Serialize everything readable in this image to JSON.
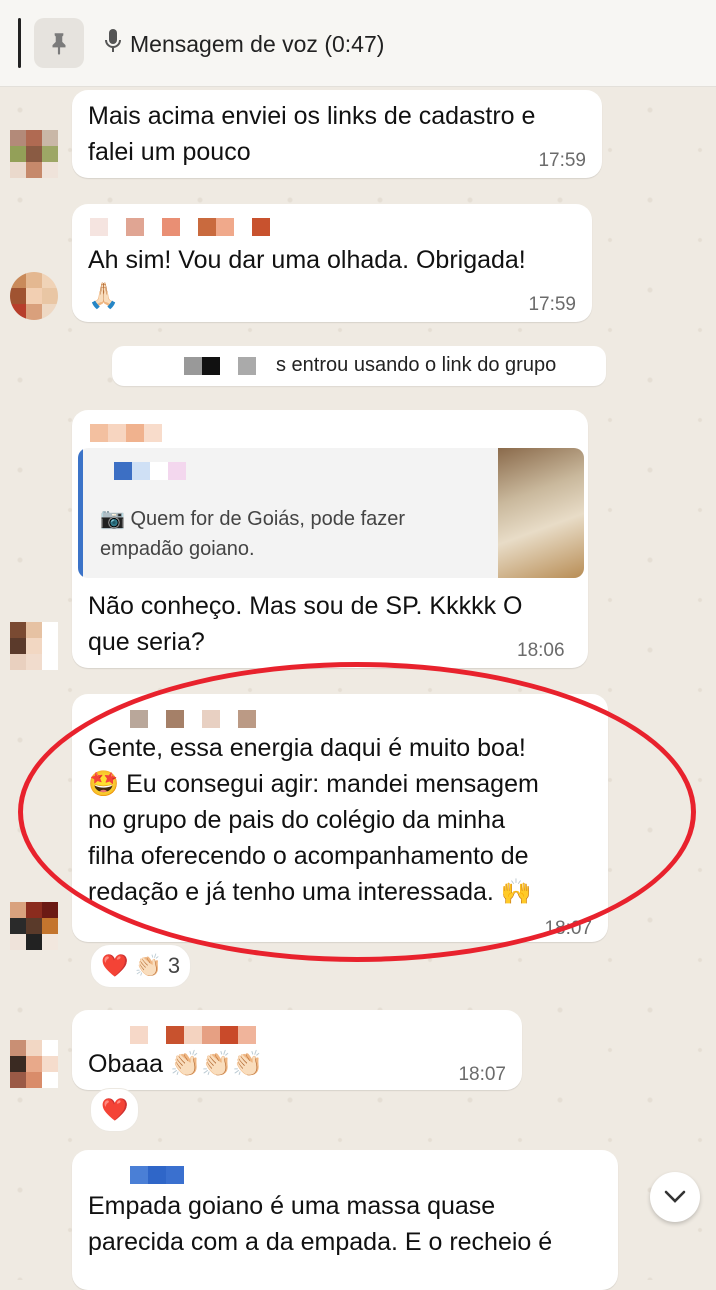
{
  "pinned": {
    "label": "Mensagem de voz (0:47)",
    "icon": "pin-icon",
    "mic_icon": "mic-icon"
  },
  "messages": [
    {
      "text": "Mais acima enviei os links de cadastro e\nfalei um pouco",
      "time": "17:59"
    },
    {
      "text": "Ah sim! Vou dar uma olhada. Obrigada!",
      "emoji": "🙏🏻",
      "time": "17:59"
    },
    {
      "quote_text": "📷 Quem for de Goiás, pode fazer\nempadão goiano.",
      "text": "Não conheço. Mas sou de SP. Kkkkk O\nque seria?",
      "time": "18:06"
    },
    {
      "text": "Gente, essa energia daqui é muito boa!\n🤩 Eu consegui agir: mandei mensagem\nno grupo de pais do colégio da minha\nfilha oferecendo o acompanhamento de\nredação e já tenho uma interessada. 🙌",
      "time": "18:07",
      "reactions": "❤️ 👏🏻",
      "reaction_count": "3"
    },
    {
      "text": "Obaaa 👏🏻👏🏻👏🏻",
      "time": "18:07",
      "reactions": "❤️"
    },
    {
      "text": "Empada goiano é uma massa quase\nparecida com a da empada. E o recheio é"
    }
  ],
  "system": {
    "text": "s entrou usando o link do grupo"
  },
  "colors": {
    "highlight_circle": "#e8222d",
    "quote_bar": "#3b73c8"
  }
}
